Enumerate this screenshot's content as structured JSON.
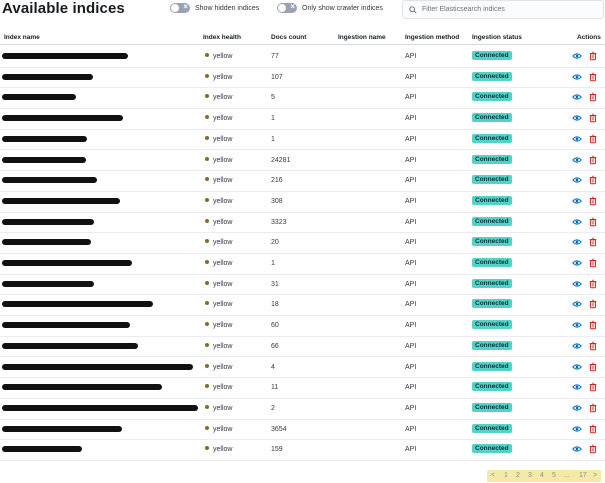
{
  "title": "Available indices",
  "toggles": [
    {
      "label": "Show hidden indices"
    },
    {
      "label": "Only show crawler indices"
    }
  ],
  "search": {
    "placeholder": "Filter Elasticsearch indices"
  },
  "columns": [
    "Index name",
    "Index health",
    "Docs count",
    "Ingestion name",
    "Ingestion method",
    "Ingestion status",
    "Actions"
  ],
  "rows": [
    {
      "health": "yellow",
      "docs": "77",
      "method": "API",
      "status": "Connected"
    },
    {
      "health": "yellow",
      "docs": "107",
      "method": "API",
      "status": "Connected"
    },
    {
      "health": "yellow",
      "docs": "5",
      "method": "API",
      "status": "Connected"
    },
    {
      "health": "yellow",
      "docs": "1",
      "method": "API",
      "status": "Connected"
    },
    {
      "health": "yellow",
      "docs": "1",
      "method": "API",
      "status": "Connected"
    },
    {
      "health": "yellow",
      "docs": "24281",
      "method": "API",
      "status": "Connected"
    },
    {
      "health": "yellow",
      "docs": "216",
      "method": "API",
      "status": "Connected"
    },
    {
      "health": "yellow",
      "docs": "308",
      "method": "API",
      "status": "Connected"
    },
    {
      "health": "yellow",
      "docs": "3323",
      "method": "API",
      "status": "Connected"
    },
    {
      "health": "yellow",
      "docs": "20",
      "method": "API",
      "status": "Connected"
    },
    {
      "health": "yellow",
      "docs": "1",
      "method": "API",
      "status": "Connected"
    },
    {
      "health": "yellow",
      "docs": "31",
      "method": "API",
      "status": "Connected"
    },
    {
      "health": "yellow",
      "docs": "18",
      "method": "API",
      "status": "Connected"
    },
    {
      "health": "yellow",
      "docs": "60",
      "method": "API",
      "status": "Connected"
    },
    {
      "health": "yellow",
      "docs": "66",
      "method": "API",
      "status": "Connected"
    },
    {
      "health": "yellow",
      "docs": "4",
      "method": "API",
      "status": "Connected"
    },
    {
      "health": "yellow",
      "docs": "11",
      "method": "API",
      "status": "Connected"
    },
    {
      "health": "yellow",
      "docs": "2",
      "method": "API",
      "status": "Connected"
    },
    {
      "health": "yellow",
      "docs": "3654",
      "method": "API",
      "status": "Connected"
    },
    {
      "health": "yellow",
      "docs": "159",
      "method": "API",
      "status": "Connected"
    }
  ],
  "pagination": {
    "prev": "<",
    "pages": [
      "1",
      "2",
      "3",
      "4",
      "5"
    ],
    "ellipsis": "...",
    "last": "17",
    "next": ">"
  },
  "colors": {
    "accent": "#006bb8",
    "status_badge": "#54d1c9",
    "health_dot": "#8a6a1f",
    "delete": "#bd271e"
  },
  "icons": {
    "view": "eye-icon",
    "delete": "trash-icon",
    "search": "search-icon"
  }
}
